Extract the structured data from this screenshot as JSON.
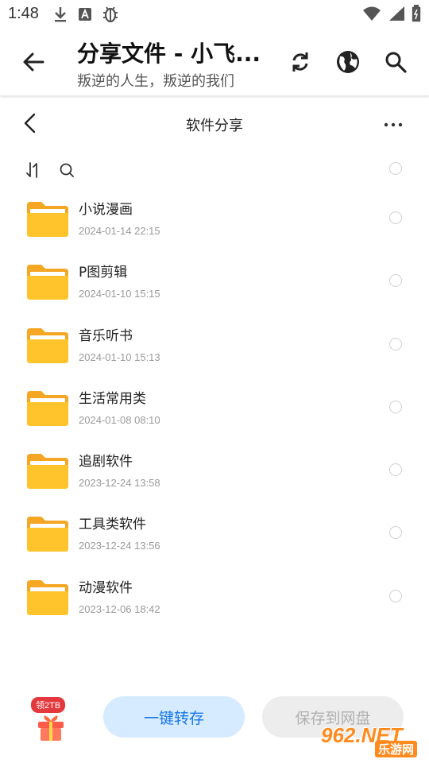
{
  "status_bar": {
    "time": "1:48"
  },
  "header": {
    "title": "分享文件 - 小飞...",
    "subtitle": "叛逆的人生，叛逆的我们"
  },
  "web_nav": {
    "title": "软件分享"
  },
  "files": [
    {
      "name": "小说漫画",
      "date": "2024-01-14 22:15"
    },
    {
      "name": "P图剪辑",
      "date": "2024-01-10 15:15"
    },
    {
      "name": "音乐听书",
      "date": "2024-01-10 15:13"
    },
    {
      "name": "生活常用类",
      "date": "2024-01-08 08:10"
    },
    {
      "name": "追剧软件",
      "date": "2023-12-24 13:58"
    },
    {
      "name": "工具类软件",
      "date": "2023-12-24 13:56"
    },
    {
      "name": "动漫软件",
      "date": "2023-12-06 18:42"
    }
  ],
  "bottom": {
    "gift_badge": "领2TB",
    "save_one_click": "一键转存",
    "save_to_disk": "保存到网盘"
  },
  "watermark": {
    "brand": "962.NET",
    "sub": "乐游网"
  },
  "colors": {
    "accent": "#1677e6",
    "folder": "#ffc42b",
    "folder_dark": "#f5a623"
  }
}
